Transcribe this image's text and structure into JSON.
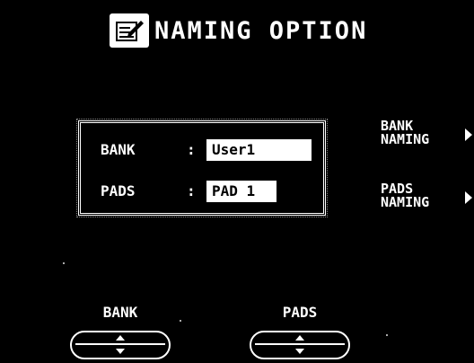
{
  "title": {
    "icon": "naming-document-icon",
    "text": "NAMING OPTION"
  },
  "fields": {
    "bank": {
      "label": "BANK",
      "separator": ":",
      "value": "User1"
    },
    "pads": {
      "label": "PADS",
      "separator": ":",
      "value": "PAD 1"
    }
  },
  "side_buttons": {
    "bank_naming": {
      "label": "BANK\nNAMING",
      "icon": "arrow-right-icon"
    },
    "pads_naming": {
      "label": "PADS\nNAMING",
      "icon": "arrow-right-icon"
    }
  },
  "rockers": {
    "bank": {
      "label": "BANK",
      "icon": "up-down-rocker-icon"
    },
    "pads": {
      "label": "PADS",
      "icon": "up-down-rocker-icon"
    }
  },
  "colors": {
    "background": "#000000",
    "foreground": "#ffffff"
  }
}
